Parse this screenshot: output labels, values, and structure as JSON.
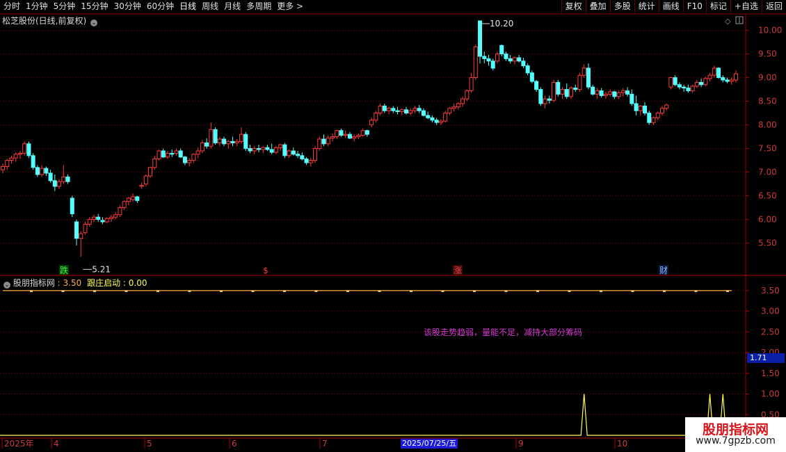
{
  "toolbar": {
    "periods": [
      "分时",
      "1分钟",
      "5分钟",
      "15分钟",
      "30分钟",
      "60分钟",
      "日线",
      "周线",
      "月线",
      "多周期",
      "更多 >"
    ],
    "active_period": "日线",
    "right_buttons": [
      "复权",
      "叠加",
      "多股",
      "统计",
      "画线",
      "F10",
      "标记",
      "+自选",
      "返回"
    ]
  },
  "main_panel": {
    "title": "松芝股份(日线,前复权)",
    "menu_icon": "chevron-down-icon",
    "right_icons": [
      "diamond-icon",
      "panel-toggle-icon"
    ]
  },
  "indicator_panel": {
    "title": "股朋指标网",
    "value1_label": "",
    "value1": "3.50",
    "value2_label": "跟庄启动",
    "value2": "0.00",
    "message": "该股走势趋弱，量能不足，减持大部分筹码",
    "current_value": "1.71"
  },
  "colors": {
    "up": "#ff3b3b",
    "down": "#54ffff",
    "grid": "#8a0000",
    "axis_text": "#c83c3c",
    "line1": "#ffb040",
    "line2": "#ffff55",
    "message": "#d63ad6"
  },
  "chart_data": [
    {
      "type": "candlestick",
      "title": "松芝股份(日线,前复权)",
      "y_ticks": [
        "10.00",
        "9.50",
        "9.00",
        "8.50",
        "8.00",
        "7.50",
        "7.00",
        "6.50",
        "6.00",
        "5.50"
      ],
      "ylim": [
        5.2,
        10.2
      ],
      "x_ticks": [
        "2025年",
        "4",
        "5",
        "6",
        "7",
        "8",
        "9",
        "10"
      ],
      "annotations": [
        {
          "text": "10.20",
          "type": "high"
        },
        {
          "text": "5.21",
          "type": "low"
        }
      ],
      "markers": [
        {
          "text": "跌",
          "color": "#3cff3c"
        },
        {
          "text": "$",
          "color": "#ff3b3b"
        },
        {
          "text": "涨",
          "color": "#ff4040"
        },
        {
          "text": "财",
          "color": "#8ab4ff"
        }
      ],
      "candles": [
        [
          7.05,
          7.18,
          6.98,
          7.12
        ],
        [
          7.12,
          7.28,
          7.05,
          7.25
        ],
        [
          7.25,
          7.35,
          7.18,
          7.3
        ],
        [
          7.3,
          7.42,
          7.22,
          7.38
        ],
        [
          7.38,
          7.45,
          7.28,
          7.4
        ],
        [
          7.4,
          7.65,
          7.35,
          7.6
        ],
        [
          7.6,
          7.65,
          7.3,
          7.35
        ],
        [
          7.35,
          7.4,
          7.05,
          7.1
        ],
        [
          7.1,
          7.15,
          6.9,
          6.95
        ],
        [
          6.95,
          7.15,
          6.9,
          7.08
        ],
        [
          7.08,
          7.12,
          6.92,
          6.98
        ],
        [
          6.98,
          7.05,
          6.78,
          6.82
        ],
        [
          6.82,
          6.95,
          6.6,
          6.7
        ],
        [
          6.7,
          6.85,
          6.65,
          6.8
        ],
        [
          6.8,
          7.15,
          6.75,
          6.9
        ],
        [
          6.9,
          6.95,
          6.75,
          6.8
        ],
        [
          6.45,
          6.5,
          6.05,
          6.12
        ],
        [
          5.95,
          6.0,
          5.45,
          5.6
        ],
        [
          5.6,
          5.75,
          5.21,
          5.7
        ],
        [
          5.72,
          5.95,
          5.68,
          5.9
        ],
        [
          5.9,
          6.05,
          5.85,
          6.0
        ],
        [
          6.0,
          6.1,
          5.95,
          6.05
        ],
        [
          6.05,
          6.12,
          5.95,
          6.0
        ],
        [
          5.98,
          6.05,
          5.9,
          5.95
        ],
        [
          5.95,
          6.05,
          5.92,
          6.02
        ],
        [
          6.02,
          6.1,
          5.95,
          6.05
        ],
        [
          6.05,
          6.15,
          6.0,
          6.1
        ],
        [
          6.1,
          6.3,
          6.05,
          6.25
        ],
        [
          6.25,
          6.4,
          6.2,
          6.38
        ],
        [
          6.38,
          6.48,
          6.3,
          6.45
        ],
        [
          6.42,
          6.55,
          6.38,
          6.48
        ],
        [
          6.48,
          6.5,
          6.35,
          6.4
        ],
        [
          6.7,
          6.78,
          6.65,
          6.72
        ],
        [
          6.75,
          6.95,
          6.7,
          6.92
        ],
        [
          6.92,
          7.12,
          6.88,
          7.1
        ],
        [
          7.1,
          7.35,
          7.05,
          7.28
        ],
        [
          7.28,
          7.48,
          7.25,
          7.45
        ],
        [
          7.45,
          7.5,
          7.3,
          7.32
        ],
        [
          7.32,
          7.45,
          7.28,
          7.4
        ],
        [
          7.4,
          7.48,
          7.32,
          7.38
        ],
        [
          7.4,
          7.5,
          7.35,
          7.45
        ],
        [
          7.45,
          7.5,
          7.3,
          7.32
        ],
        [
          7.32,
          7.35,
          7.15,
          7.2
        ],
        [
          7.2,
          7.3,
          7.12,
          7.25
        ],
        [
          7.25,
          7.4,
          7.2,
          7.38
        ],
        [
          7.38,
          7.52,
          7.3,
          7.45
        ],
        [
          7.45,
          7.68,
          7.4,
          7.62
        ],
        [
          7.62,
          7.72,
          7.5,
          7.55
        ],
        [
          7.55,
          8.05,
          7.5,
          7.9
        ],
        [
          7.9,
          7.95,
          7.58,
          7.62
        ],
        [
          7.62,
          7.75,
          7.55,
          7.7
        ],
        [
          7.7,
          7.75,
          7.55,
          7.6
        ],
        [
          7.6,
          7.68,
          7.5,
          7.65
        ],
        [
          7.65,
          7.75,
          7.55,
          7.62
        ],
        [
          7.62,
          7.7,
          7.55,
          7.65
        ],
        [
          7.65,
          7.95,
          7.6,
          7.8
        ],
        [
          7.8,
          7.85,
          7.45,
          7.5
        ],
        [
          7.5,
          7.58,
          7.4,
          7.45
        ],
        [
          7.45,
          7.55,
          7.38,
          7.5
        ],
        [
          7.5,
          7.58,
          7.42,
          7.48
        ],
        [
          7.48,
          7.55,
          7.4,
          7.52
        ],
        [
          7.52,
          7.58,
          7.45,
          7.48
        ],
        [
          7.48,
          7.6,
          7.38,
          7.42
        ],
        [
          7.42,
          7.55,
          7.38,
          7.52
        ],
        [
          7.52,
          7.6,
          7.45,
          7.58
        ],
        [
          7.58,
          7.62,
          7.3,
          7.35
        ],
        [
          7.35,
          7.48,
          7.3,
          7.45
        ],
        [
          7.45,
          7.52,
          7.35,
          7.38
        ],
        [
          7.38,
          7.45,
          7.3,
          7.35
        ],
        [
          7.35,
          7.42,
          7.25,
          7.28
        ],
        [
          7.28,
          7.32,
          7.15,
          7.2
        ],
        [
          7.2,
          7.3,
          7.12,
          7.25
        ],
        [
          7.25,
          7.55,
          7.2,
          7.5
        ],
        [
          7.5,
          7.75,
          7.45,
          7.7
        ],
        [
          7.7,
          7.8,
          7.55,
          7.6
        ],
        [
          7.6,
          7.78,
          7.55,
          7.72
        ],
        [
          7.72,
          7.82,
          7.65,
          7.75
        ],
        [
          7.75,
          7.9,
          7.7,
          7.88
        ],
        [
          7.88,
          7.92,
          7.75,
          7.78
        ],
        [
          7.78,
          7.88,
          7.72,
          7.8
        ],
        [
          7.8,
          7.85,
          7.7,
          7.72
        ],
        [
          7.72,
          7.8,
          7.65,
          7.75
        ],
        [
          7.75,
          7.82,
          7.7,
          7.78
        ],
        [
          7.78,
          7.92,
          7.75,
          7.88
        ],
        [
          7.88,
          7.9,
          7.75,
          7.8
        ],
        [
          8.0,
          8.15,
          7.95,
          8.1
        ],
        [
          8.1,
          8.3,
          8.05,
          8.25
        ],
        [
          8.25,
          8.45,
          8.2,
          8.4
        ],
        [
          8.4,
          8.45,
          8.25,
          8.3
        ],
        [
          8.3,
          8.38,
          8.22,
          8.35
        ],
        [
          8.35,
          8.4,
          8.25,
          8.3
        ],
        [
          8.3,
          8.38,
          8.22,
          8.28
        ],
        [
          8.28,
          8.35,
          8.2,
          8.32
        ],
        [
          8.32,
          8.38,
          8.22,
          8.25
        ],
        [
          8.25,
          8.35,
          8.2,
          8.3
        ],
        [
          8.3,
          8.4,
          8.25,
          8.35
        ],
        [
          8.35,
          8.42,
          8.25,
          8.3
        ],
        [
          8.3,
          8.35,
          8.18,
          8.2
        ],
        [
          8.2,
          8.28,
          8.12,
          8.15
        ],
        [
          8.15,
          8.2,
          8.05,
          8.1
        ],
        [
          8.1,
          8.15,
          8.0,
          8.05
        ],
        [
          8.05,
          8.12,
          8.0,
          8.08
        ],
        [
          8.08,
          8.3,
          8.05,
          8.25
        ],
        [
          8.25,
          8.38,
          8.2,
          8.35
        ],
        [
          8.35,
          8.45,
          8.28,
          8.38
        ],
        [
          8.38,
          8.48,
          8.32,
          8.45
        ],
        [
          8.45,
          8.6,
          8.38,
          8.55
        ],
        [
          8.55,
          8.75,
          8.5,
          8.72
        ],
        [
          8.72,
          9.1,
          8.68,
          9.0
        ],
        [
          9.0,
          9.7,
          8.95,
          9.65
        ],
        [
          10.2,
          10.2,
          9.3,
          9.45
        ],
        [
          9.45,
          9.55,
          9.3,
          9.4
        ],
        [
          9.4,
          9.48,
          9.25,
          9.35
        ],
        [
          9.35,
          9.4,
          9.15,
          9.2
        ],
        [
          9.35,
          9.55,
          9.3,
          9.5
        ],
        [
          9.68,
          9.7,
          9.45,
          9.5
        ],
        [
          9.5,
          9.55,
          9.35,
          9.4
        ],
        [
          9.4,
          9.48,
          9.3,
          9.35
        ],
        [
          9.35,
          9.45,
          9.28,
          9.42
        ],
        [
          9.42,
          9.48,
          9.32,
          9.35
        ],
        [
          9.35,
          9.42,
          9.2,
          9.25
        ],
        [
          9.25,
          9.3,
          9.05,
          9.1
        ],
        [
          9.1,
          9.15,
          8.88,
          8.92
        ],
        [
          8.92,
          8.95,
          8.7,
          8.75
        ],
        [
          8.75,
          8.8,
          8.4,
          8.45
        ],
        [
          8.45,
          8.62,
          8.35,
          8.55
        ],
        [
          8.55,
          8.62,
          8.45,
          8.52
        ],
        [
          8.52,
          8.95,
          8.48,
          8.9
        ],
        [
          8.9,
          8.95,
          8.6,
          8.65
        ],
        [
          8.65,
          8.8,
          8.55,
          8.75
        ],
        [
          8.75,
          8.88,
          8.55,
          8.6
        ],
        [
          8.6,
          8.82,
          8.55,
          8.78
        ],
        [
          8.78,
          8.85,
          8.7,
          8.75
        ],
        [
          8.75,
          9.1,
          8.7,
          9.05
        ],
        [
          9.05,
          9.28,
          9.0,
          9.2
        ],
        [
          9.2,
          9.3,
          8.75,
          8.8
        ],
        [
          8.8,
          8.85,
          8.62,
          8.65
        ],
        [
          8.65,
          8.78,
          8.55,
          8.72
        ],
        [
          8.72,
          8.78,
          8.58,
          8.62
        ],
        [
          8.62,
          8.7,
          8.55,
          8.65
        ],
        [
          8.65,
          8.75,
          8.6,
          8.7
        ],
        [
          8.7,
          8.72,
          8.55,
          8.6
        ],
        [
          8.6,
          8.72,
          8.55,
          8.68
        ],
        [
          8.68,
          8.78,
          8.6,
          8.72
        ],
        [
          8.72,
          8.8,
          8.6,
          8.65
        ],
        [
          8.65,
          8.75,
          8.4,
          8.45
        ],
        [
          8.45,
          8.62,
          8.2,
          8.3
        ],
        [
          8.3,
          8.42,
          8.2,
          8.4
        ],
        [
          8.4,
          8.48,
          8.2,
          8.25
        ],
        [
          8.25,
          8.3,
          8.0,
          8.05
        ],
        [
          8.05,
          8.18,
          8.0,
          8.15
        ],
        [
          8.15,
          8.28,
          8.1,
          8.25
        ],
        [
          8.25,
          8.4,
          8.2,
          8.35
        ],
        [
          8.35,
          8.45,
          8.3,
          8.42
        ],
        [
          8.8,
          9.02,
          8.75,
          9.0
        ],
        [
          9.0,
          9.05,
          8.82,
          8.85
        ],
        [
          8.85,
          8.9,
          8.75,
          8.8
        ],
        [
          8.8,
          8.85,
          8.7,
          8.78
        ],
        [
          8.78,
          8.85,
          8.68,
          8.72
        ],
        [
          8.72,
          8.85,
          8.68,
          8.82
        ],
        [
          8.82,
          8.95,
          8.78,
          8.9
        ],
        [
          8.9,
          8.98,
          8.8,
          8.85
        ],
        [
          8.85,
          9.02,
          8.82,
          8.98
        ],
        [
          8.98,
          9.1,
          8.92,
          9.05
        ],
        [
          9.05,
          9.25,
          9.0,
          9.2
        ],
        [
          9.2,
          9.22,
          8.98,
          9.0
        ],
        [
          9.0,
          9.05,
          8.9,
          8.95
        ],
        [
          8.95,
          9.0,
          8.88,
          8.92
        ],
        [
          8.92,
          9.0,
          8.85,
          8.95
        ],
        [
          8.95,
          9.15,
          8.9,
          9.08
        ]
      ]
    },
    {
      "type": "line",
      "title": "股朋指标网",
      "y_ticks": [
        "3.50",
        "3.00",
        "2.50",
        "2.00",
        "1.50",
        "1.00",
        "0.50"
      ],
      "ylim": [
        0.0,
        3.8
      ],
      "series": [
        {
          "name": "",
          "constant": 3.5
        },
        {
          "name": "跟庄启动",
          "pulse_indices": [
            134,
            163,
            166,
            195
          ]
        }
      ],
      "x_highlight": "2025/07/25/五"
    }
  ],
  "watermark": {
    "line1": "股朋指标网",
    "line2": "www.7gpzb.com"
  }
}
